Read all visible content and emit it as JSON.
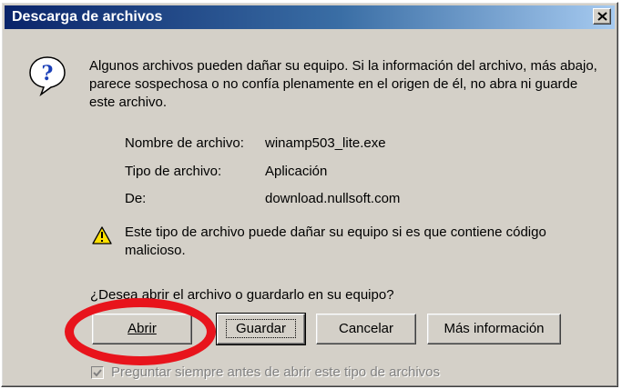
{
  "window": {
    "title": "Descarga de archivos",
    "close_label": "Cerrar"
  },
  "message": {
    "intro": "Algunos archivos pueden dañar su equipo. Si la información del archivo, más abajo, parece sospechosa o no confía plenamente en el origen de él, no abra ni guarde este archivo."
  },
  "file_info": {
    "name_label": "Nombre de archivo:",
    "name_value": "winamp503_lite.exe",
    "type_label": "Tipo de archivo:",
    "type_value": "Aplicación",
    "from_label": "De:",
    "from_value": "download.nullsoft.com"
  },
  "warning": {
    "text": "Este tipo de archivo puede dañar su equipo si es que contiene código malicioso."
  },
  "question": "¿Desea abrir el archivo o guardarlo en su equipo?",
  "buttons": {
    "open": "Abrir",
    "save": "Guardar",
    "cancel": "Cancelar",
    "more_info": "Más información"
  },
  "checkbox": {
    "label": "Preguntar siempre antes de abrir este tipo de archivos",
    "checked": true,
    "enabled": false
  },
  "icons": {
    "question": "question-icon",
    "warning": "warning-icon",
    "close": "close-icon"
  },
  "colors": {
    "title_bar_start": "#0a246a",
    "title_bar_end": "#a6caf0",
    "dialog_bg": "#d4d0c8",
    "highlight_oval": "#e8141c"
  }
}
